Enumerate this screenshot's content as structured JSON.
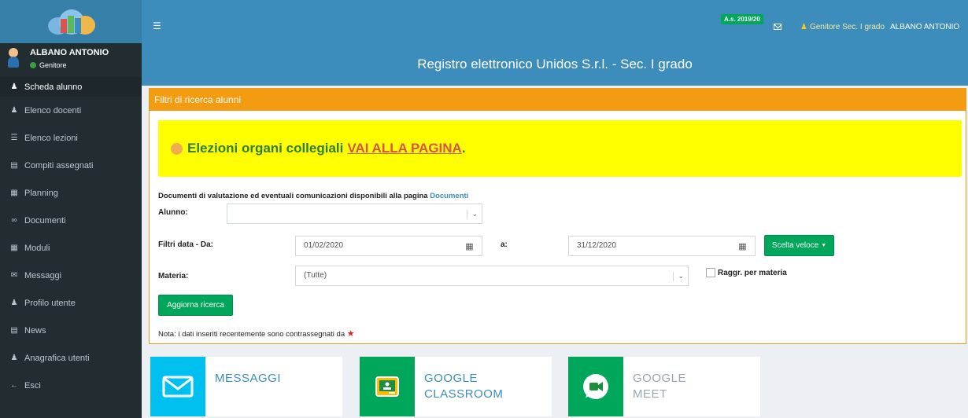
{
  "header": {
    "school_year_badge": "A.s. 2019/20",
    "role_label": "Genitore Sec. I grado",
    "user_label": "ALBANO ANTONIO",
    "page_title": "Registro elettronico Unidos S.r.l. - Sec. I grado"
  },
  "sidebar": {
    "user_name": "ALBANO ANTONIO",
    "user_role": "Genitore",
    "items": [
      {
        "label": "Scheda alunno",
        "icon": "child-icon"
      },
      {
        "label": "Elenco docenti",
        "icon": "group-icon"
      },
      {
        "label": "Elenco lezioni",
        "icon": "list-icon"
      },
      {
        "label": "Compiti assegnati",
        "icon": "document-icon"
      },
      {
        "label": "Planning",
        "icon": "calendar-icon"
      },
      {
        "label": "Documenti",
        "icon": "paperclip-icon"
      },
      {
        "label": "Moduli",
        "icon": "form-icon"
      },
      {
        "label": "Messaggi",
        "icon": "envelope-icon"
      },
      {
        "label": "Profilo utente",
        "icon": "user-icon"
      },
      {
        "label": "News",
        "icon": "newspaper-icon"
      },
      {
        "label": "Anagrafica utenti",
        "icon": "group-icon"
      },
      {
        "label": "Esci",
        "icon": "arrow-left-icon"
      }
    ]
  },
  "filters": {
    "panel_title": "Filtri di ricerca alunni",
    "alert_text": "Elezioni organi collegiali",
    "alert_link": "VAI ALLA PAGINA",
    "alert_end": ".",
    "doc_note_text": "Documenti di valutazione ed eventuali comunicazioni disponibili alla pagina",
    "doc_note_link": "Documenti",
    "student_label": "Alunno:",
    "student_value": "",
    "date_from_label": "Filtri data - Da:",
    "date_from_value": "01/02/2020",
    "date_to_label": "a:",
    "date_to_value": "31/12/2020",
    "quick_choice_label": "Scelta veloce",
    "subject_label": "Materia:",
    "subject_value": "(Tutte)",
    "group_by_label": "Raggr. per materia",
    "refresh_label": "Aggiorna ricerca",
    "note_text": "Nota: i dati inseriti recentemente sono contrassegnati da"
  },
  "tiles": [
    {
      "line1": "MESSAGGI",
      "line2": "",
      "color": "#00c0ef"
    },
    {
      "line1": "GOOGLE",
      "line2": "CLASSROOM",
      "color": "#00a65a"
    },
    {
      "line1": "GOOGLE",
      "line2": "MEET",
      "color": "#00a65a"
    }
  ],
  "colors": {
    "primary": "#3c8dbc",
    "sidebar": "#222d32",
    "warning": "#f39c12",
    "success": "#00a65a",
    "info": "#00c0ef"
  }
}
